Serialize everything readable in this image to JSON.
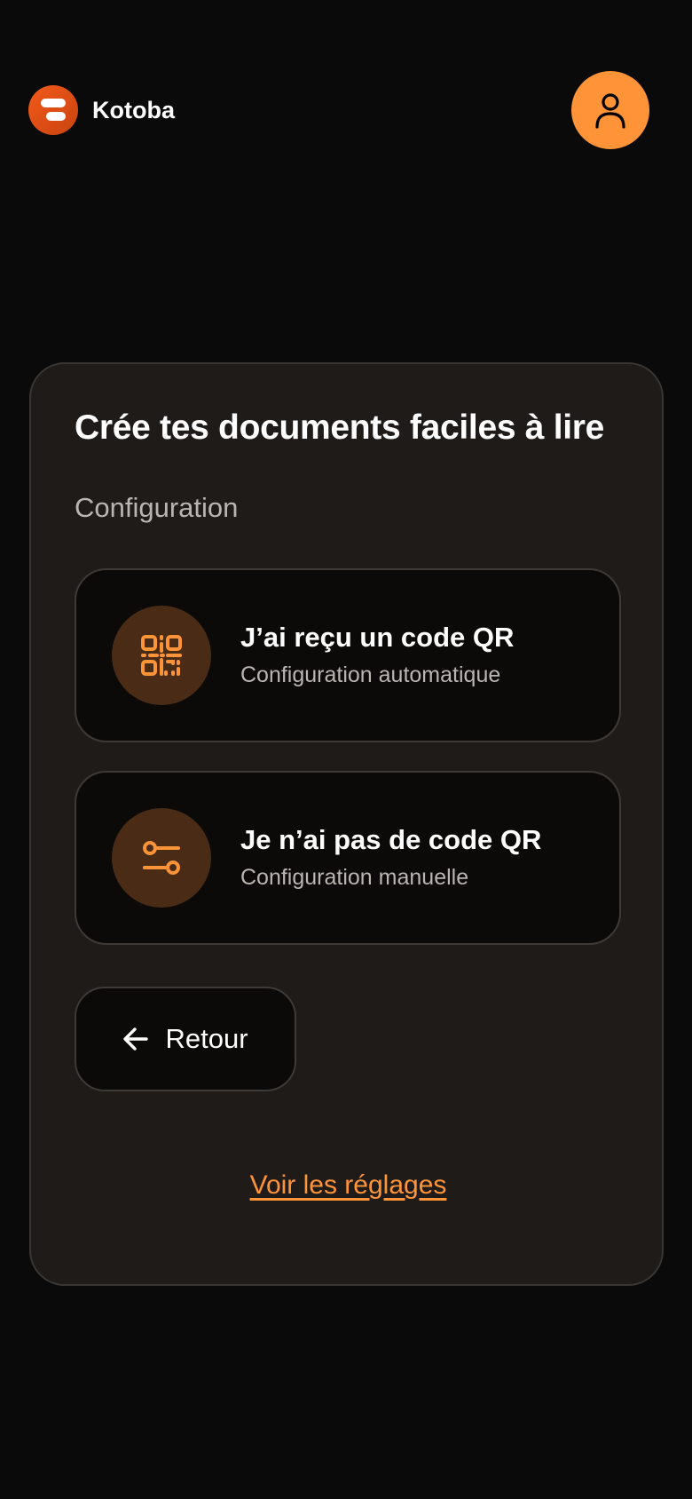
{
  "brand": {
    "name": "Kotoba",
    "logo_icon": "kotoba-logo",
    "logo_color": "#f2591a"
  },
  "header": {
    "account_icon": "user-icon",
    "accent_color": "#fe9338"
  },
  "card": {
    "title": "Crée tes documents faciles à lire",
    "subtitle": "Configuration",
    "options": [
      {
        "icon": "qr-code-icon",
        "title": "J’ai reçu un code QR",
        "description": "Configuration automatique"
      },
      {
        "icon": "sliders-icon",
        "title": "Je n’ai pas de code QR",
        "description": "Configuration manuelle"
      }
    ],
    "back_button": {
      "icon": "arrow-left-icon",
      "label": "Retour"
    },
    "settings_link": "Voir les réglages"
  }
}
